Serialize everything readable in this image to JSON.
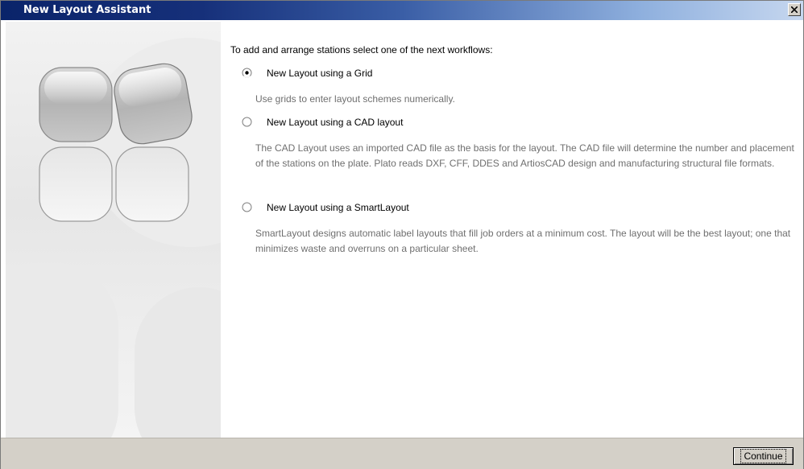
{
  "window": {
    "title": "New Layout Assistant",
    "close_icon": "close-icon"
  },
  "content": {
    "intro": "To add and arrange stations select one of the next workflows:",
    "options": [
      {
        "label": "New Layout using a Grid",
        "selected": true,
        "description": "Use grids to enter layout schemes numerically."
      },
      {
        "label": "New Layout using a CAD layout",
        "selected": false,
        "description": "The CAD Layout uses an imported CAD file as the basis for the layout. The CAD file will determine the number and placement of the stations on the plate. Plato reads DXF, CFF, DDES and ArtiosCAD design and manufacturing structural file formats."
      },
      {
        "label": "New Layout using a SmartLayout",
        "selected": false,
        "description": "SmartLayout designs automatic label layouts that fill job orders at a minimum cost. The layout will be the best layout; one that minimizes waste and overruns on a particular sheet."
      }
    ]
  },
  "footer": {
    "continue_label": "Continue"
  },
  "colors": {
    "title_bar_start": "#0a246a",
    "title_bar_end": "#c6d7ef",
    "description_text": "#6f6f6f",
    "dialog_face": "#d4d0c8"
  }
}
